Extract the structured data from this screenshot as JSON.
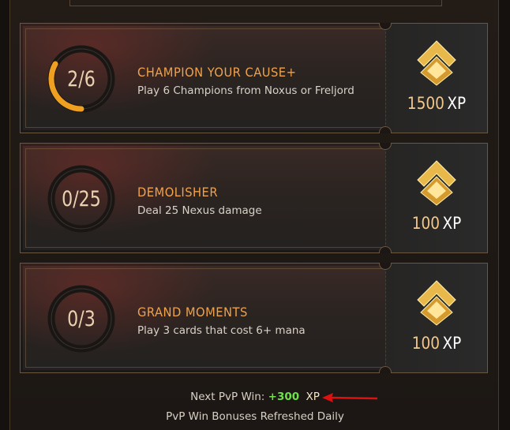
{
  "quests": [
    {
      "progress_text": "2/6",
      "progress_fraction": 0.333,
      "title": "CHAMPION YOUR CAUSE+",
      "description": "Play 6 Champions from Noxus or Freljord",
      "reward_value": "1500",
      "reward_unit": "XP",
      "icon": "gold-chevron-icon"
    },
    {
      "progress_text": "0/25",
      "progress_fraction": 0,
      "title": "DEMOLISHER",
      "description": "Deal 25 Nexus damage",
      "reward_value": "100",
      "reward_unit": "XP",
      "icon": "gold-chevron-icon"
    },
    {
      "progress_text": "0/3",
      "progress_fraction": 0,
      "title": "GRAND MOMENTS",
      "description": "Play 3 cards that cost 6+ mana",
      "reward_value": "100",
      "reward_unit": "XP",
      "icon": "gold-chevron-icon"
    }
  ],
  "footer": {
    "next_win_label": "Next PvP Win:",
    "next_win_bonus": "+300",
    "next_win_unit": "XP",
    "refresh_note": "PvP Win Bonuses Refreshed Daily"
  },
  "colors": {
    "progress_ring": "#f0a020",
    "title": "#f0a24a",
    "bonus": "#6fe04a",
    "annotation_arrow": "#e01010"
  }
}
